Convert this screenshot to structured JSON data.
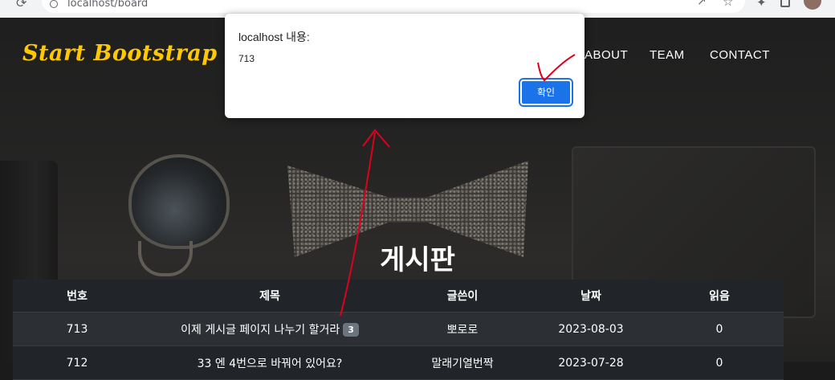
{
  "browser": {
    "url": "localhost/board"
  },
  "navbar": {
    "brand": "Start Bootstrap",
    "items": [
      "ABOUT",
      "TEAM",
      "CONTACT"
    ]
  },
  "alert_dialog": {
    "title": "localhost 내용:",
    "message": "713",
    "ok_label": "확인"
  },
  "page": {
    "title": "게시판"
  },
  "board": {
    "headers": [
      "번호",
      "제목",
      "글쓴이",
      "날짜",
      "읽음"
    ],
    "rows": [
      {
        "no": "713",
        "title": "이제 게시글 페이지 나누기 할거라",
        "comments": "3",
        "author": "뽀로로",
        "date": "2023-08-03",
        "views": "0"
      },
      {
        "no": "712",
        "title": "33 엔 4번으로 바꿔어 있어요?",
        "comments": "",
        "author": "말래기열번짝",
        "date": "2023-07-28",
        "views": "0"
      }
    ]
  },
  "colors": {
    "brand": "#ffc800",
    "dialog_button": "#1a73e8",
    "annotation": "#e0001b",
    "table_header": "#212529"
  },
  "icons": [
    "reload-icon",
    "info-icon",
    "share-icon",
    "star-icon",
    "extensions-icon",
    "side-panel-icon",
    "profile-avatar"
  ]
}
